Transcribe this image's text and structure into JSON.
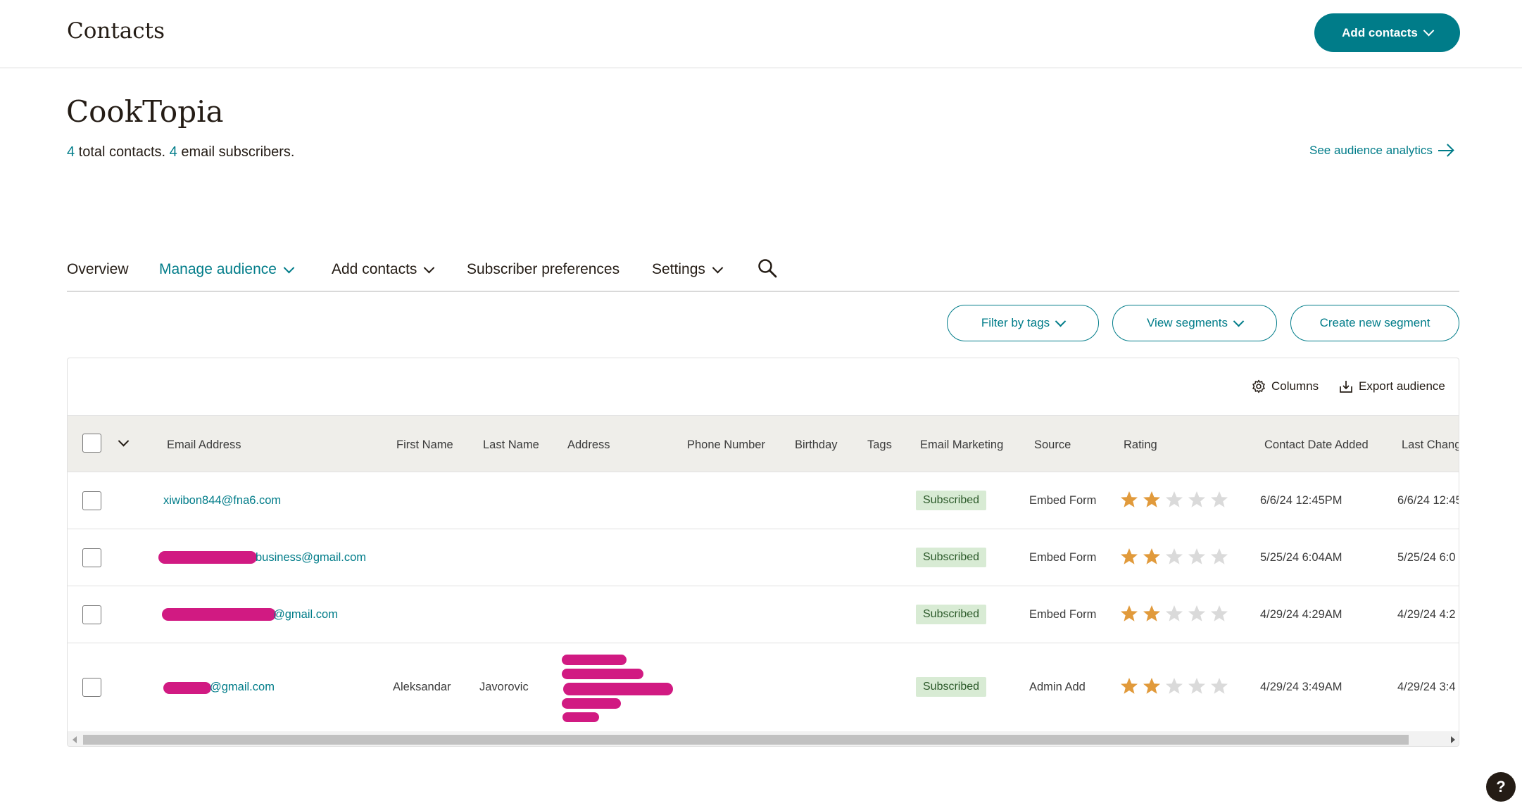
{
  "header": {
    "title": "Contacts",
    "add_contacts_label": "Add contacts"
  },
  "audience": {
    "name": "CookTopia",
    "total_count": "4",
    "total_text": " total contacts. ",
    "subscriber_count": "4",
    "subscriber_text": " email subscribers.",
    "analytics_link": "See audience analytics"
  },
  "nav": {
    "overview": "Overview",
    "manage_audience": "Manage audience",
    "add_contacts": "Add contacts",
    "subscriber_preferences": "Subscriber preferences",
    "settings": "Settings"
  },
  "segment_buttons": {
    "filter_by_tags": "Filter by tags",
    "view_segments": "View segments",
    "create_new_segment": "Create new segment"
  },
  "table_tools": {
    "columns": "Columns",
    "export": "Export audience"
  },
  "columns": [
    "Email Address",
    "First Name",
    "Last Name",
    "Address",
    "Phone Number",
    "Birthday",
    "Tags",
    "Email Marketing",
    "Source",
    "Rating",
    "Contact Date Added",
    "Last Chang"
  ],
  "rows": [
    {
      "email": "xiwibon844@fna6.com",
      "first_name": "",
      "last_name": "",
      "status": "Subscribed",
      "source": "Embed Form",
      "rating": 2,
      "added": "6/6/24 12:45PM",
      "last_changed": "6/6/24 12:45"
    },
    {
      "email": "business@gmail.com",
      "first_name": "",
      "last_name": "",
      "status": "Subscribed",
      "source": "Embed Form",
      "rating": 2,
      "added": "5/25/24 6:04AM",
      "last_changed": "5/25/24 6:0"
    },
    {
      "email": "@gmail.com",
      "first_name": "",
      "last_name": "",
      "status": "Subscribed",
      "source": "Embed Form",
      "rating": 2,
      "added": "4/29/24 4:29AM",
      "last_changed": "4/29/24 4:2"
    },
    {
      "email": "@gmail.com",
      "first_name": "Aleksandar",
      "last_name": "Javorovic",
      "status": "Subscribed",
      "source": "Admin Add",
      "rating": 2,
      "added": "4/29/24 3:49AM",
      "last_changed": "4/29/24 3:4"
    }
  ],
  "rating_max": 5,
  "colors": {
    "accent": "#007c89",
    "star_filled": "#e19a3b",
    "star_empty": "#dadada",
    "badge_bg": "#d8ebd4",
    "redaction": "#d11a82"
  },
  "icons": {
    "search": "search-icon",
    "columns": "gear-icon",
    "export": "export-icon",
    "help": "help-icon"
  },
  "help_label": "?"
}
